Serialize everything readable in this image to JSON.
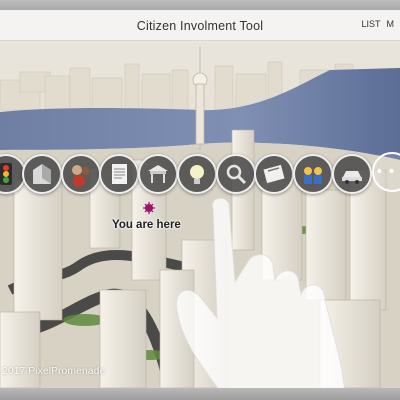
{
  "header": {
    "title": "Citizen Involment Tool",
    "links": [
      "LIST",
      "M"
    ]
  },
  "toolbar": {
    "tools": [
      {
        "icon": "traffic-light-icon"
      },
      {
        "icon": "building-icon"
      },
      {
        "icon": "people-icon"
      },
      {
        "icon": "document-icon"
      },
      {
        "icon": "market-stall-icon"
      },
      {
        "icon": "lightbulb-icon"
      },
      {
        "icon": "search-icon"
      },
      {
        "icon": "newspaper-icon"
      },
      {
        "icon": "group-icon"
      },
      {
        "icon": "car-icon"
      }
    ],
    "more_label": "• • •"
  },
  "map": {
    "you_are_here": "You are here",
    "marker_color": "#a0126e"
  },
  "footer": {
    "copyright": "2017 PixelPromenade"
  }
}
